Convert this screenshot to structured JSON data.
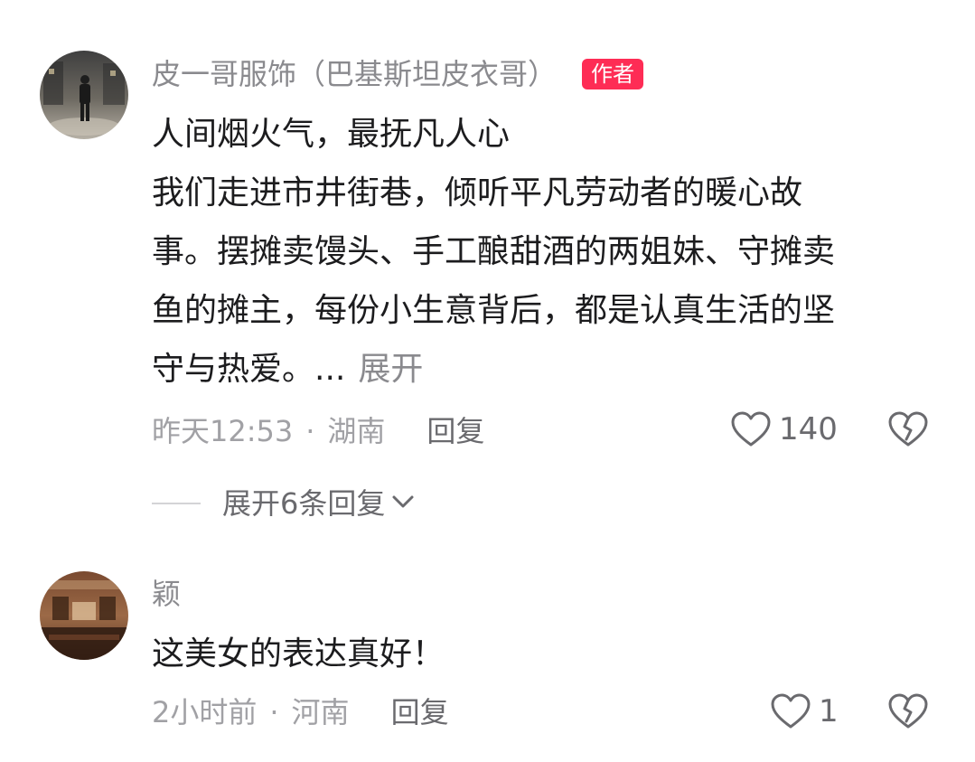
{
  "comments": [
    {
      "author": "皮一哥服饰（巴基斯坦皮衣哥）",
      "badge": "作者",
      "text_lines": [
        "人间烟火气，最抚凡人心",
        "我们走进市井街巷，倾听平凡劳动者的暖心故",
        "事。摆摊卖馒头、手工酿甜酒的两姐妹、守摊卖",
        "鱼的摊主，每份小生意背后，都是认真生活的坚",
        "守与热爱。..."
      ],
      "expand_label": "展开",
      "time": "昨天12:53",
      "separator": "·",
      "location": "湖南",
      "reply_label": "回复",
      "like_count": "140",
      "expand_replies_label": "展开6条回复"
    },
    {
      "author": "颖",
      "text_lines": [
        "这美女的表达真好！"
      ],
      "time": "2小时前",
      "separator": "·",
      "location": "河南",
      "reply_label": "回复",
      "like_count": "1"
    }
  ]
}
